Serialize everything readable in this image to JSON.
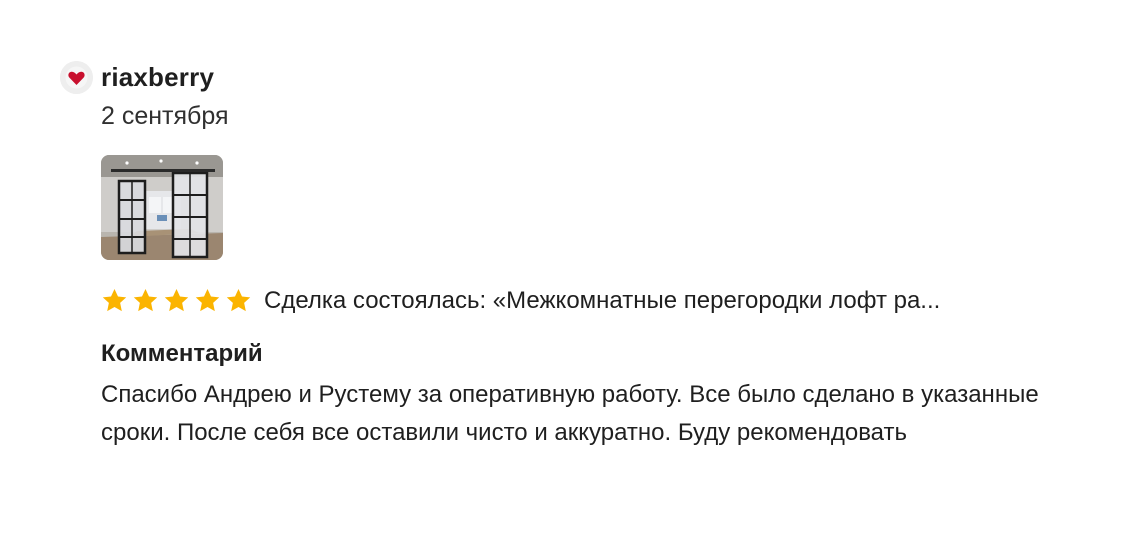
{
  "review": {
    "author": "riaxberry",
    "date": "2 сентября",
    "avatar_icon": "heart-avatar-icon",
    "photo": "room-partition-photo",
    "rating": {
      "value": 5,
      "max": 5,
      "star_color": "#fbb400"
    },
    "deal_text": "Сделка состоялась: «Межкомнатные перегородки лофт ра...",
    "comment_heading": "Комментарий",
    "comment_text": "Спасибо Андрею и Рустему за оперативную работу. Все было сделано в указанные сроки. После себя все оставили чисто и аккуратно. Буду рекомендовать"
  },
  "colors": {
    "text": "#1f1f1f",
    "star": "#fbb400",
    "heart": "#c8102e"
  }
}
